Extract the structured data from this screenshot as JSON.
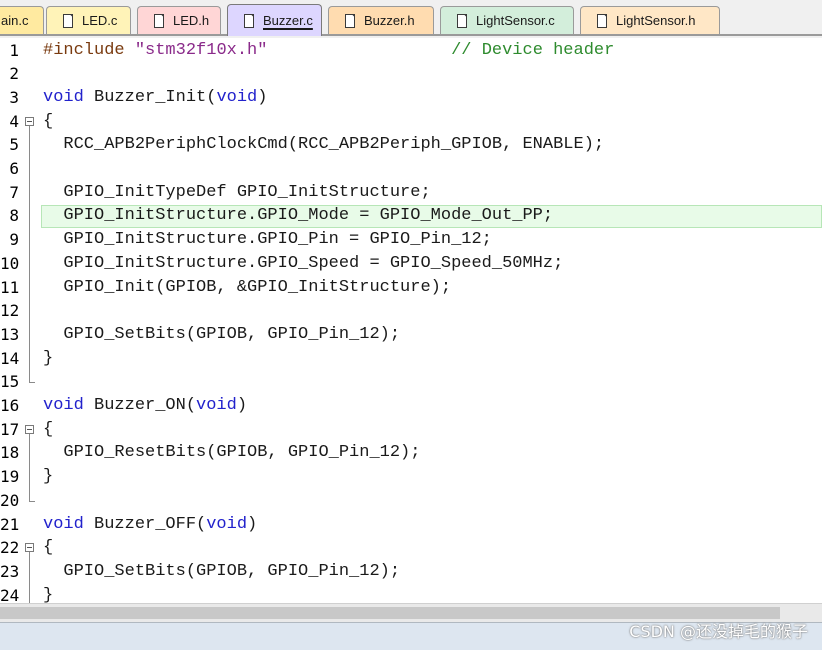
{
  "tabs": [
    {
      "label": "ain.c",
      "color": "#ffeaa0",
      "active": false
    },
    {
      "label": "LED.c",
      "color": "#fff3b8",
      "active": false
    },
    {
      "label": "LED.h",
      "color": "#ffd6d6",
      "active": false
    },
    {
      "label": "Buzzer.c",
      "color": "#ddd6ff",
      "active": true
    },
    {
      "label": "Buzzer.h",
      "color": "#ffdcb0",
      "active": false
    },
    {
      "label": "LightSensor.c",
      "color": "#d3eedb",
      "active": false
    },
    {
      "label": "LightSensor.h",
      "color": "#ffe7c6",
      "active": false
    }
  ],
  "editor": {
    "highlight_line": "8",
    "lines": [
      {
        "n": "1",
        "tokens": [
          {
            "t": "pp",
            "v": "#include "
          },
          {
            "t": "str",
            "v": "\"stm32f10x.h\""
          },
          {
            "t": "tx",
            "v": "                  "
          },
          {
            "t": "cm",
            "v": "// Device header"
          }
        ]
      },
      {
        "n": "2",
        "tokens": []
      },
      {
        "n": "3",
        "tokens": [
          {
            "t": "kw",
            "v": "void"
          },
          {
            "t": "tx",
            "v": " Buzzer_Init("
          },
          {
            "t": "kw",
            "v": "void"
          },
          {
            "t": "tx",
            "v": ")"
          }
        ]
      },
      {
        "n": "4",
        "tokens": [
          {
            "t": "tx",
            "v": "{"
          }
        ],
        "fold": "open"
      },
      {
        "n": "5",
        "tokens": [
          {
            "t": "tx",
            "v": "  RCC_APB2PeriphClockCmd(RCC_APB2Periph_GPIOB, ENABLE);"
          }
        ]
      },
      {
        "n": "6",
        "tokens": []
      },
      {
        "n": "7",
        "tokens": [
          {
            "t": "tx",
            "v": "  GPIO_InitTypeDef GPIO_InitStructure;"
          }
        ]
      },
      {
        "n": "8",
        "tokens": [
          {
            "t": "tx",
            "v": "  GPIO_InitStructure.GPIO_Mode = GPIO_Mode_Out_PP;"
          }
        ]
      },
      {
        "n": "9",
        "tokens": [
          {
            "t": "tx",
            "v": "  GPIO_InitStructure.GPIO_Pin = GPIO_Pin_12;"
          }
        ]
      },
      {
        "n": "10",
        "tokens": [
          {
            "t": "tx",
            "v": "  GPIO_InitStructure.GPIO_Speed = GPIO_Speed_50MHz;"
          }
        ]
      },
      {
        "n": "11",
        "tokens": [
          {
            "t": "tx",
            "v": "  GPIO_Init(GPIOB, &GPIO_InitStructure);"
          }
        ]
      },
      {
        "n": "12",
        "tokens": []
      },
      {
        "n": "13",
        "tokens": [
          {
            "t": "tx",
            "v": "  GPIO_SetBits(GPIOB, GPIO_Pin_12);"
          }
        ]
      },
      {
        "n": "14",
        "tokens": [
          {
            "t": "tx",
            "v": "}"
          }
        ]
      },
      {
        "n": "15",
        "tokens": [],
        "fold": "end"
      },
      {
        "n": "16",
        "tokens": [
          {
            "t": "kw",
            "v": "void"
          },
          {
            "t": "tx",
            "v": " Buzzer_ON("
          },
          {
            "t": "kw",
            "v": "void"
          },
          {
            "t": "tx",
            "v": ")"
          }
        ]
      },
      {
        "n": "17",
        "tokens": [
          {
            "t": "tx",
            "v": "{"
          }
        ],
        "fold": "open"
      },
      {
        "n": "18",
        "tokens": [
          {
            "t": "tx",
            "v": "  GPIO_ResetBits(GPIOB, GPIO_Pin_12);"
          }
        ]
      },
      {
        "n": "19",
        "tokens": [
          {
            "t": "tx",
            "v": "}"
          }
        ]
      },
      {
        "n": "20",
        "tokens": [],
        "fold": "end"
      },
      {
        "n": "21",
        "tokens": [
          {
            "t": "kw",
            "v": "void"
          },
          {
            "t": "tx",
            "v": " Buzzer_OFF("
          },
          {
            "t": "kw",
            "v": "void"
          },
          {
            "t": "tx",
            "v": ")"
          }
        ]
      },
      {
        "n": "22",
        "tokens": [
          {
            "t": "tx",
            "v": "{"
          }
        ],
        "fold": "open"
      },
      {
        "n": "23",
        "tokens": [
          {
            "t": "tx",
            "v": "  GPIO_SetBits(GPIOB, GPIO_Pin_12);"
          }
        ]
      },
      {
        "n": "24",
        "tokens": [
          {
            "t": "tx",
            "v": "}"
          }
        ]
      }
    ]
  },
  "watermark": "CSDN @还没掉毛的猴子",
  "icons": {
    "tab_file_icon": "file-icon",
    "fold_marker": "fold-minus-icon"
  }
}
